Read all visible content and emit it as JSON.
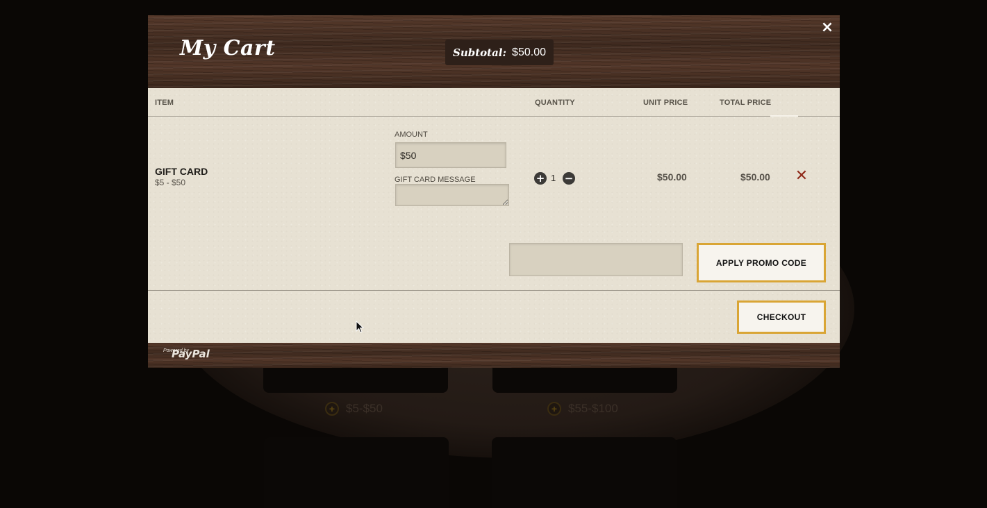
{
  "cart": {
    "title": "My Cart",
    "subtotal_label": "Subtotal:",
    "subtotal_value": "$50.00",
    "close_icon": "×"
  },
  "columns": {
    "item": "ITEM",
    "quantity": "QUANTITY",
    "unit_price": "UNIT PRICE",
    "total_price": "TOTAL PRICE"
  },
  "line_item": {
    "name": "GIFT CARD",
    "range": "$5 - $50",
    "amount_label": "AMOUNT",
    "amount_value": "$50",
    "message_label": "GIFT CARD MESSAGE",
    "message_value": "",
    "quantity": "1",
    "plus_icon": "+",
    "minus_icon": "−",
    "unit_price": "$50.00",
    "total_price": "$50.00",
    "remove_icon": "✕"
  },
  "promo": {
    "input_value": "",
    "button_label": "APPLY PROMO CODE"
  },
  "checkout": {
    "button_label": "CHECKOUT"
  },
  "footer": {
    "powered_by": "Powered by",
    "paypal": "PayPal"
  },
  "background": {
    "prices": [
      "$5-$50",
      "$55-$100"
    ],
    "price_icon": "+"
  },
  "colors": {
    "accent_gold": "#d9a535",
    "remove_red": "#8f2a1a",
    "wood": "#4a3124",
    "paper": "#e7e1d3"
  }
}
